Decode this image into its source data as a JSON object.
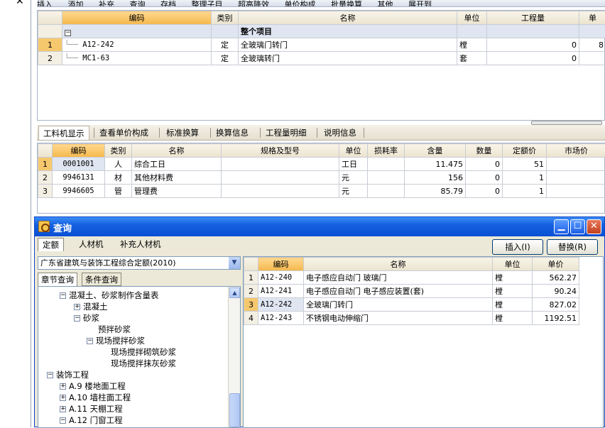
{
  "toolbar": {
    "items": [
      "插入",
      "添加",
      "补充",
      "查询",
      "存档",
      "整理子目",
      "超高降效",
      "单价构成",
      "批量换算",
      "其他",
      "展开到"
    ]
  },
  "upper_grid": {
    "headers": [
      "编码",
      "类别",
      "名称",
      "单位",
      "工程量",
      "单"
    ],
    "group_label": "整个项目",
    "rows": [
      {
        "no": "1",
        "code": "A12-242",
        "type": "定",
        "name": "全玻璃门转门",
        "unit": "樘",
        "qty": "0",
        "extra": "8"
      },
      {
        "no": "2",
        "code": "MC1-63",
        "type": "定",
        "name": "全玻璃转门",
        "unit": "套",
        "qty": "0",
        "extra": ""
      }
    ]
  },
  "detail_tabs": [
    "工料机显示",
    "查看单价构成",
    "标准换算",
    "换算信息",
    "工程量明细",
    "说明信息"
  ],
  "lower_grid": {
    "headers": [
      "编码",
      "类别",
      "名称",
      "规格及型号",
      "单位",
      "损耗率",
      "含量",
      "数量",
      "定额价",
      "市场价"
    ],
    "rows": [
      {
        "no": "1",
        "code": "0001001",
        "type": "人",
        "name": "综合工日",
        "spec": "",
        "unit": "工日",
        "loss": "",
        "content": "11.475",
        "qty": "0",
        "price": "51"
      },
      {
        "no": "2",
        "code": "9946131",
        "type": "材",
        "name": "其他材料费",
        "spec": "",
        "unit": "元",
        "loss": "",
        "content": "156",
        "qty": "0",
        "price": "1"
      },
      {
        "no": "3",
        "code": "9946605",
        "type": "管",
        "name": "管理费",
        "spec": "",
        "unit": "元",
        "loss": "",
        "content": "85.79",
        "qty": "0",
        "price": "1"
      }
    ]
  },
  "dialog": {
    "title": "查询",
    "tabs": [
      "定额",
      "人材机",
      "补充人材机"
    ],
    "insert_button": "插入(I)",
    "replace_button": "替换(R)",
    "quota_library": "广东省建筑与装饰工程综合定额(2010)",
    "subtabs": [
      "章节查询",
      "条件查询"
    ],
    "tree": [
      {
        "label": "混凝土、砂浆制作含量表",
        "sign": "⊟"
      },
      {
        "label": "混凝土",
        "sign": "⊞"
      },
      {
        "label": "砂浆",
        "sign": "⊟"
      },
      {
        "label": "预拌砂浆",
        "sign": ""
      },
      {
        "label": "现场搅拌砂浆",
        "sign": "⊟"
      },
      {
        "label": "现场搅拌砌筑砂浆",
        "sign": ""
      },
      {
        "label": "现场搅拌抹灰砂浆",
        "sign": ""
      },
      {
        "label": "装饰工程",
        "sign": "⊟"
      },
      {
        "label": "A.9 楼地面工程",
        "sign": "⊞"
      },
      {
        "label": "A.10 墙柱面工程",
        "sign": "⊞"
      },
      {
        "label": "A.11 天棚工程",
        "sign": "⊞"
      },
      {
        "label": "A.12 门窗工程",
        "sign": "⊟"
      }
    ],
    "result_grid": {
      "headers": [
        "编码",
        "名称",
        "单位",
        "单价"
      ],
      "rows": [
        {
          "no": "1",
          "code": "A12-240",
          "name": "电子感应自动门 玻璃门",
          "unit": "樘",
          "price": "562.27"
        },
        {
          "no": "2",
          "code": "A12-241",
          "name": "电子感应自动门 电子感应装置(套)",
          "unit": "樘",
          "price": "90.24"
        },
        {
          "no": "3",
          "code": "A12-242",
          "name": "全玻璃门转门",
          "unit": "樘",
          "price": "827.02"
        },
        {
          "no": "4",
          "code": "A12-243",
          "name": "不锈钢电动伸缩门",
          "unit": "樘",
          "price": "1192.51"
        }
      ]
    }
  }
}
